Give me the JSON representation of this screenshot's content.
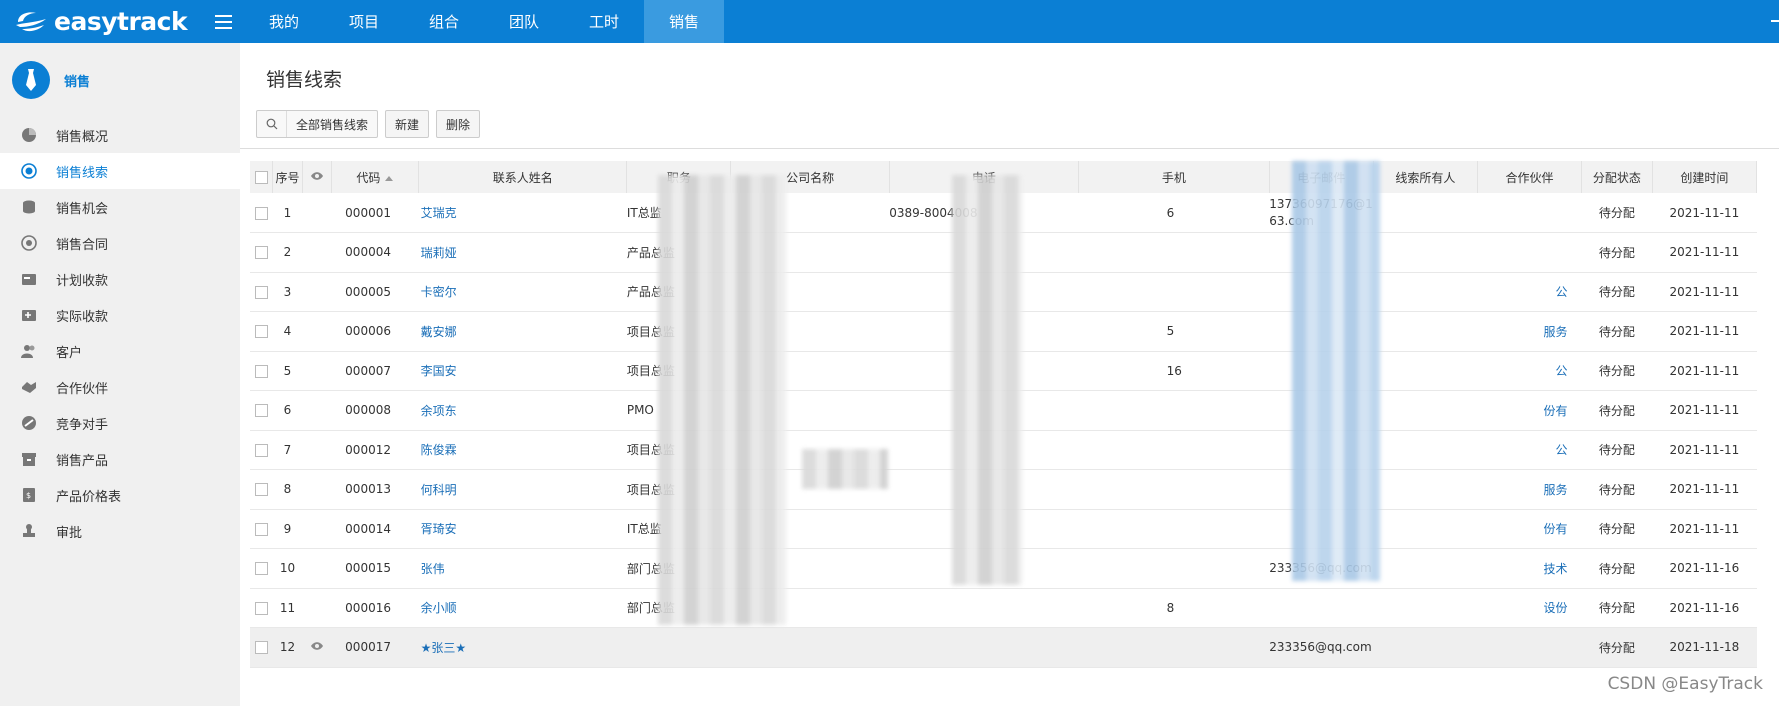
{
  "app": {
    "logo_text": "easytrack",
    "brand_color": "#0b7fd4"
  },
  "topnav": {
    "items": [
      {
        "label": "我的"
      },
      {
        "label": "项目"
      },
      {
        "label": "组合"
      },
      {
        "label": "团队"
      },
      {
        "label": "工时"
      },
      {
        "label": "销售",
        "active": true
      }
    ]
  },
  "sidebar": {
    "title": "销售",
    "items": [
      {
        "label": "销售概况",
        "icon": "pie-chart-icon"
      },
      {
        "label": "销售线索",
        "icon": "target-icon",
        "active": true
      },
      {
        "label": "销售机会",
        "icon": "coins-icon"
      },
      {
        "label": "销售合同",
        "icon": "contract-icon"
      },
      {
        "label": "计划收款",
        "icon": "planned-payment-icon"
      },
      {
        "label": "实际收款",
        "icon": "actual-payment-icon"
      },
      {
        "label": "客户",
        "icon": "customers-icon"
      },
      {
        "label": "合作伙伴",
        "icon": "handshake-icon"
      },
      {
        "label": "竞争对手",
        "icon": "competitor-icon"
      },
      {
        "label": "销售产品",
        "icon": "product-box-icon"
      },
      {
        "label": "产品价格表",
        "icon": "price-list-icon"
      },
      {
        "label": "审批",
        "icon": "approval-stamp-icon"
      }
    ]
  },
  "main": {
    "title": "销售线索",
    "filter_label": "全部销售线索",
    "new_label": "新建",
    "delete_label": "删除"
  },
  "table": {
    "headers": {
      "index": "序号",
      "code": "代码",
      "contact": "联系人姓名",
      "position": "职务",
      "company": "公司名称",
      "phone": "电话",
      "mobile": "手机",
      "email": "电子邮件",
      "owner": "线索所有人",
      "partner": "合作伙伴",
      "status": "分配状态",
      "created": "创建时间"
    },
    "rows": [
      {
        "index": "1",
        "code": "000001",
        "contact": "艾瑞克",
        "position": "IT总监",
        "phone": "0389-8004008",
        "mobile_tail": "6",
        "email": "13736097176@163.com",
        "partner_tail": "",
        "status": "待分配",
        "created": "2021-11-11"
      },
      {
        "index": "2",
        "code": "000004",
        "contact": "瑞莉娅",
        "position": "产品总监",
        "phone": "",
        "mobile_tail": "",
        "email": "",
        "partner_tail": "",
        "status": "待分配",
        "created": "2021-11-11"
      },
      {
        "index": "3",
        "code": "000005",
        "contact": "卡密尔",
        "position": "产品总监",
        "phone": "",
        "mobile_tail": "",
        "email": "",
        "partner_tail": "公",
        "status": "待分配",
        "created": "2021-11-11"
      },
      {
        "index": "4",
        "code": "000006",
        "contact": "戴安娜",
        "position": "项目总监",
        "phone": "",
        "mobile_tail": "5",
        "email": "",
        "partner_tail": "服务",
        "status": "待分配",
        "created": "2021-11-11"
      },
      {
        "index": "5",
        "code": "000007",
        "contact": "李国安",
        "position": "项目总监",
        "phone": "",
        "mobile_tail": "16",
        "email": "",
        "partner_tail": "公",
        "status": "待分配",
        "created": "2021-11-11"
      },
      {
        "index": "6",
        "code": "000008",
        "contact": "余项东",
        "position": "PMO",
        "phone": "",
        "mobile_tail": "",
        "email": "",
        "partner_tail": "份有",
        "status": "待分配",
        "created": "2021-11-11"
      },
      {
        "index": "7",
        "code": "000012",
        "contact": "陈俊霖",
        "position": "项目总监",
        "phone": "",
        "mobile_tail": "",
        "email": "",
        "partner_tail": "公",
        "status": "待分配",
        "created": "2021-11-11"
      },
      {
        "index": "8",
        "code": "000013",
        "contact": "何科明",
        "position": "项目总监",
        "phone": "",
        "mobile_tail": "",
        "email": "",
        "partner_tail": "服务",
        "status": "待分配",
        "created": "2021-11-11"
      },
      {
        "index": "9",
        "code": "000014",
        "contact": "胥琦安",
        "position": "IT总监",
        "phone": "",
        "mobile_tail": "",
        "email": "",
        "partner_tail": "份有",
        "status": "待分配",
        "created": "2021-11-11"
      },
      {
        "index": "10",
        "code": "000015",
        "contact": "张伟",
        "position": "部门总监",
        "phone": "",
        "mobile_tail": "",
        "email": "233356@qq.com",
        "partner_tail": "技术",
        "status": "待分配",
        "created": "2021-11-16"
      },
      {
        "index": "11",
        "code": "000016",
        "contact": "余小顺",
        "position": "部门总监",
        "phone": "",
        "mobile_tail": "8",
        "email": "",
        "partner_tail": "设份",
        "status": "待分配",
        "created": "2021-11-16"
      },
      {
        "index": "12",
        "code": "000017",
        "contact": "★张三★",
        "position": "",
        "phone": "",
        "mobile_tail": "",
        "email": "233356@qq.com",
        "partner_tail": "",
        "status": "待分配",
        "created": "2021-11-18",
        "viewed": true
      }
    ]
  },
  "watermark": "CSDN @EasyTrack"
}
